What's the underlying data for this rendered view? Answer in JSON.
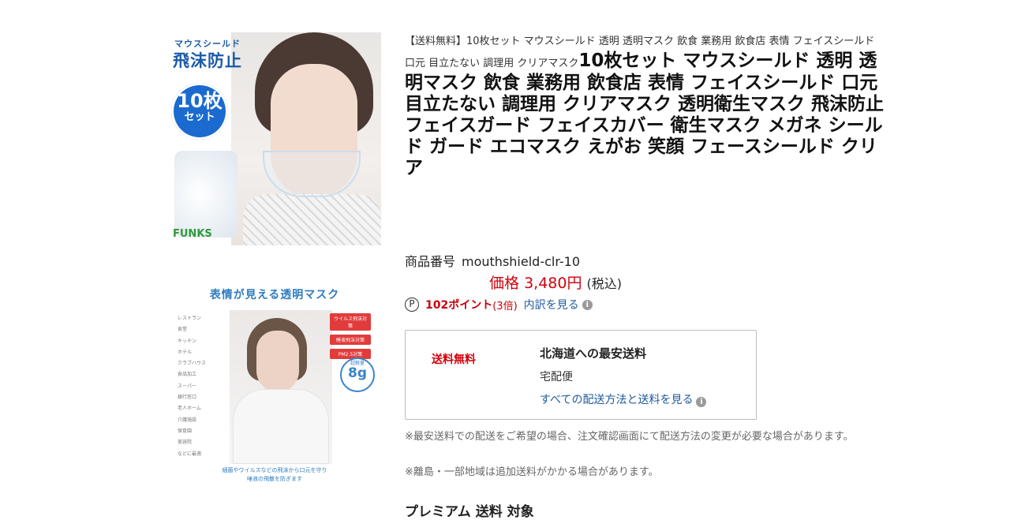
{
  "images": {
    "main": {
      "small_text": "マウスシールド",
      "big_text": "飛沫防止",
      "badge_number": "10枚",
      "badge_text": "セット",
      "logo": "FUNKS"
    },
    "second": {
      "header": "表情が見える透明マスク",
      "list": [
        "レストラン",
        "食堂",
        "キッチン",
        "ホテル",
        "クラブハウス",
        "食品加工",
        "スーパー",
        "銀行窓口",
        "老人ホーム",
        "介護施設",
        "保育園",
        "美容院",
        "などに最適"
      ],
      "tags": [
        "ウイルス飛沫対策",
        "睡液飛沫対策",
        "PM2.5対策"
      ],
      "weight_label": "超軽量",
      "weight_value": "8g",
      "footer_line1": "細菌やウイルスなどの飛沫から口元を守り",
      "footer_line2": "唾液の飛散を防ぎます"
    }
  },
  "product": {
    "title_prefix": "【送料無料】10枚セット マウスシールド 透明 透明マスク 飲食 業務用 飲食店 表情 フェイスシールド 口元 目立たない 調理用 クリアマスク",
    "title_main": "10枚セット マウスシールド 透明 透明マスク 飲食 業務用 飲食店 表情 フェイスシールド 口元 目立たない 調理用 クリアマスク 透明衛生マスク 飛沫防止 フェイスガード フェイスカバー 衛生マスク メガネ シールド ガード エコマスク えがお 笑顔 フェースシールド クリア",
    "item_number_label": "商品番号",
    "item_number": "mouthshield-clr-10",
    "price_label": "価格",
    "price": "3,480円",
    "tax": "(税込)",
    "points_icon": "P",
    "points": "102ポイント",
    "points_multiplier": "(3倍)",
    "points_link": "内訳を見る"
  },
  "shipping": {
    "free": "送料無料",
    "title": "北海道への最安送料",
    "method": "宅配便",
    "link": "すべての配送方法と送料を見る"
  },
  "notes": {
    "note1": "※最安送料での配送をご希望の場合、注文確認画面にて配送方法の変更が必要な場合があります。",
    "note2": "※離島・一部地域は追加送料がかかる場合があります。"
  },
  "section": {
    "cut_heading": "プレミアム 送料 対象"
  }
}
